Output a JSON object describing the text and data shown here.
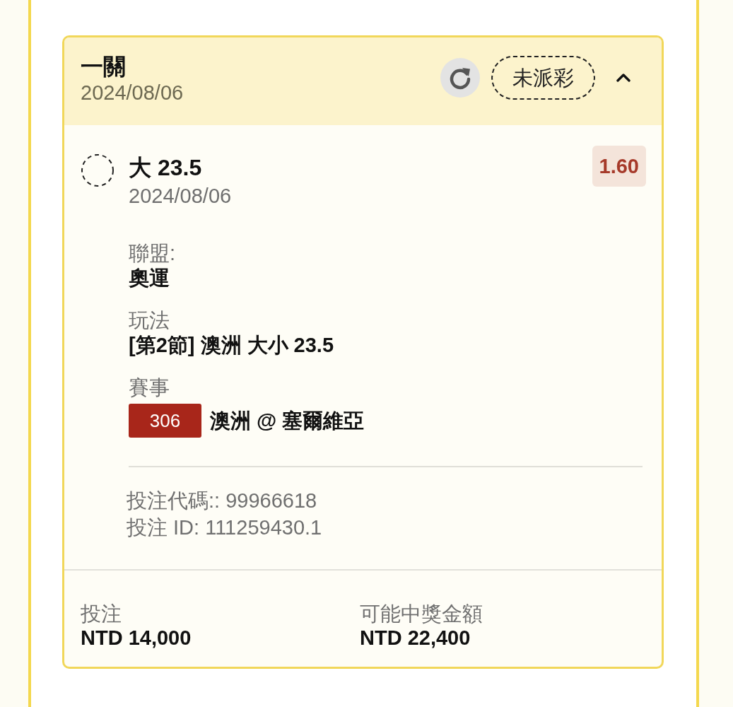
{
  "bet_card": {
    "title": "一關",
    "date": "2024/08/06",
    "status": "未派彩",
    "expanded": true,
    "selection": {
      "name": "大 23.5",
      "date": "2024/08/06",
      "odds": "1.60",
      "details": [
        {
          "kind": "text",
          "label": "聯盟:",
          "value": "奧運"
        },
        {
          "kind": "text",
          "label": "玩法",
          "value": "[第2節] 澳洲 大小 23.5"
        },
        {
          "kind": "event",
          "label": "賽事",
          "badge": "306",
          "value": "澳洲 @ 塞爾維亞"
        }
      ],
      "codes": [
        "投注代碼:: 99966618",
        "投注 ID: 111259430.1"
      ]
    },
    "summary": [
      {
        "label": "投注",
        "value": "NTD 14,000"
      },
      {
        "label": "可能中獎金額",
        "value": "NTD 22,400"
      }
    ]
  }
}
